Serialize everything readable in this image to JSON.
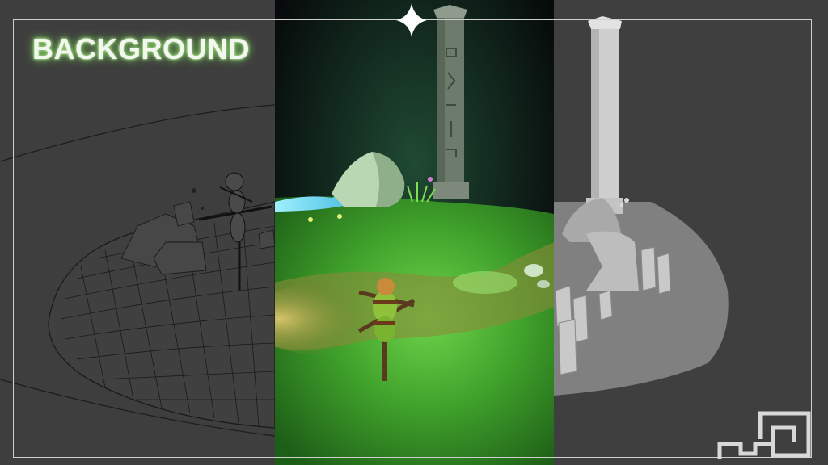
{
  "header": {
    "title": "BACKGROUND"
  },
  "panels": [
    {
      "name": "wireframe-view"
    },
    {
      "name": "textured-render-view"
    },
    {
      "name": "clay-render-view"
    }
  ],
  "icons": {
    "star": "sparkle-star-icon",
    "logo": "meander-logo-icon"
  },
  "colors": {
    "background": "#3d3d3d",
    "title_glow": "#9be07a",
    "grass": "#3fa02a",
    "grass_light": "#6fd34a",
    "water": "#58d7f0",
    "wire": "#1a1a1a",
    "clay": "#d7d7d7"
  }
}
